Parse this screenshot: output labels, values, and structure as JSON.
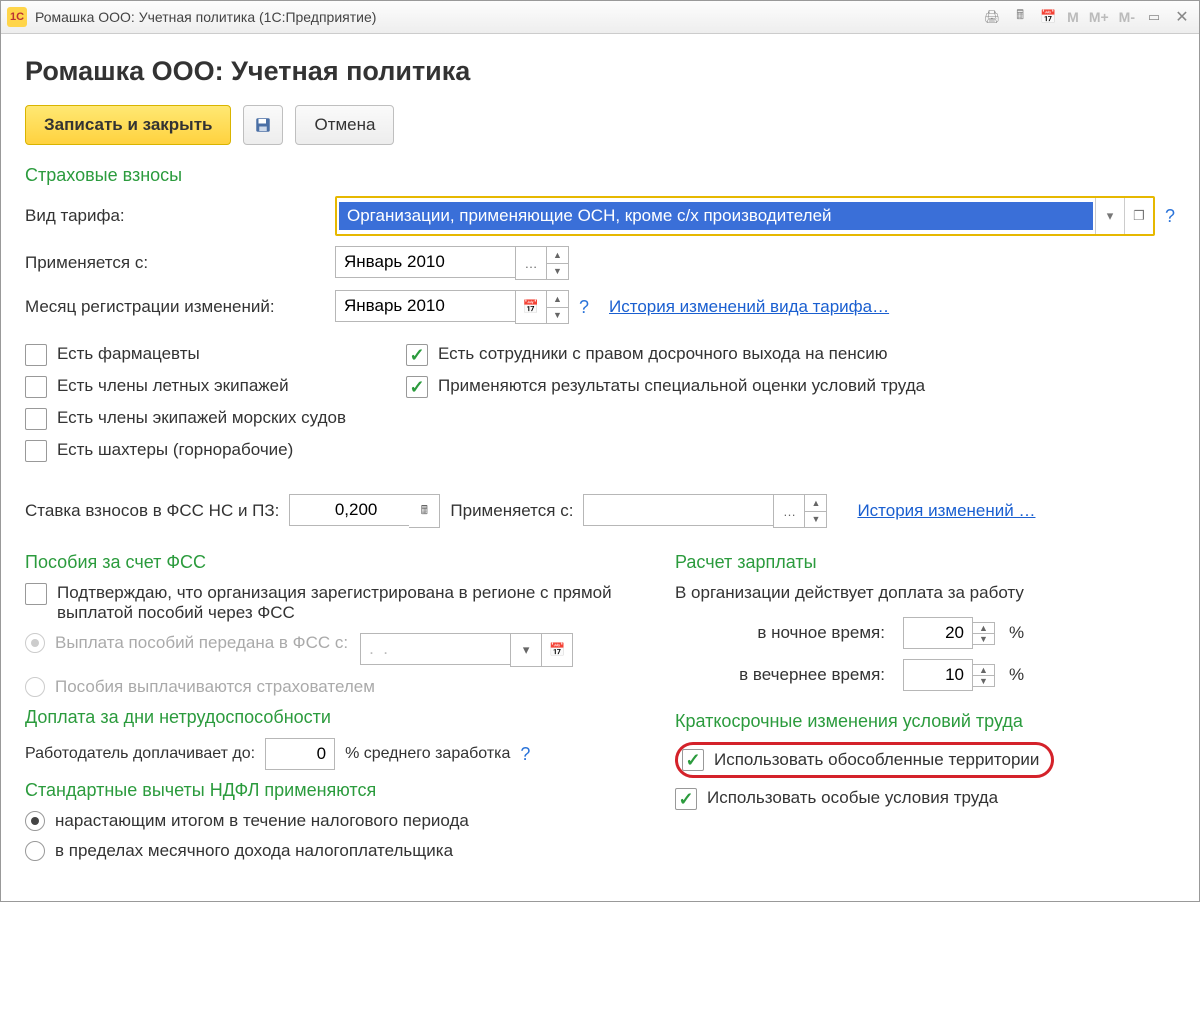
{
  "titlebar": {
    "logo": "1C",
    "title": "Ромашка ООО: Учетная политика  (1С:Предприятие)",
    "m_icons": [
      "M",
      "M+",
      "M-"
    ]
  },
  "header": {
    "title": "Ромашка ООО: Учетная политика"
  },
  "toolbar": {
    "save_close": "Записать и закрыть",
    "cancel": "Отмена"
  },
  "insurance": {
    "section": "Страховые взносы",
    "tariff_label": "Вид тарифа:",
    "tariff_value": "Организации, применяющие ОСН, кроме с/х производителей",
    "apply_from_label": "Применяется с:",
    "apply_from_value": "Январь 2010",
    "reg_month_label": "Месяц регистрации изменений:",
    "reg_month_value": "Январь 2010",
    "history_link": "История изменений вида тарифа…"
  },
  "checks": {
    "left": [
      {
        "label": "Есть фармацевты",
        "checked": false
      },
      {
        "label": "Есть члены летных экипажей",
        "checked": false
      },
      {
        "label": "Есть члены экипажей морских судов",
        "checked": false
      },
      {
        "label": "Есть шахтеры (горнорабочие)",
        "checked": false
      }
    ],
    "right": [
      {
        "label": "Есть сотрудники с правом досрочного выхода на пенсию",
        "checked": true
      },
      {
        "label": "Применяются результаты специальной оценки условий труда",
        "checked": true
      }
    ]
  },
  "fss_rate": {
    "label": "Ставка взносов в ФСС НС и ПЗ:",
    "value": "0,200",
    "apply_label": "Применяется с:",
    "apply_value": "",
    "history": "История изменений …"
  },
  "fss_benefits": {
    "section": "Пособия за счет ФСС",
    "confirm": "Подтверждаю, что организация зарегистрирована в регионе с прямой выплатой пособий через ФСС",
    "opt1": "Выплата пособий передана в ФСС с:",
    "opt1_date": ".  .",
    "opt2": "Пособия выплачиваются страхователем"
  },
  "sick_pay": {
    "section": "Доплата за дни нетрудоспособности",
    "label": "Работодатель доплачивает до:",
    "value": "0",
    "suffix": "% среднего заработка"
  },
  "ndfl": {
    "section": "Стандартные вычеты НДФЛ применяются",
    "opt1": "нарастающим итогом в течение налогового периода",
    "opt2": "в пределах месячного дохода налогоплательщика"
  },
  "salary": {
    "section": "Расчет зарплаты",
    "intro": "В организации действует доплата за работу",
    "night_label": "в ночное время:",
    "night_value": "20",
    "evening_label": "в вечернее время:",
    "evening_value": "10",
    "pct": "%"
  },
  "shortterm": {
    "section": "Краткосрочные изменения условий труда",
    "territories": "Использовать обособленные территории",
    "conditions": "Использовать особые условия труда"
  }
}
